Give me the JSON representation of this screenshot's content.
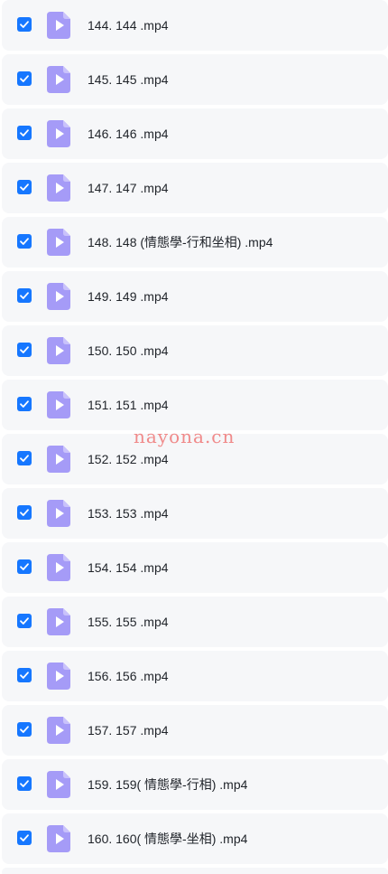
{
  "files": [
    {
      "name": "144. 144 .mp4",
      "checked": true
    },
    {
      "name": "145. 145 .mp4",
      "checked": true
    },
    {
      "name": "146. 146 .mp4",
      "checked": true
    },
    {
      "name": "147. 147 .mp4",
      "checked": true
    },
    {
      "name": "148. 148 (情態學-行和坐相) .mp4",
      "checked": true
    },
    {
      "name": "149. 149 .mp4",
      "checked": true
    },
    {
      "name": "150. 150 .mp4",
      "checked": true
    },
    {
      "name": "151. 151 .mp4",
      "checked": true
    },
    {
      "name": "152. 152 .mp4",
      "checked": true
    },
    {
      "name": "153. 153 .mp4",
      "checked": true
    },
    {
      "name": "154. 154 .mp4",
      "checked": true
    },
    {
      "name": "155. 155 .mp4",
      "checked": true
    },
    {
      "name": "156. 156 .mp4",
      "checked": true
    },
    {
      "name": "157. 157 .mp4",
      "checked": true
    },
    {
      "name": "159. 159( 情態學-行相) .mp4",
      "checked": true
    },
    {
      "name": "160. 160( 情態學-坐相) .mp4",
      "checked": true
    }
  ],
  "watermark": "nayona.cn",
  "colors": {
    "checkbox": "#1677ff",
    "file_icon": "#a59bf7",
    "row_background": "#f6f7f9",
    "watermark": "#f08a8a"
  },
  "icons": {
    "checkbox": "checkmark-icon",
    "file": "video-file-icon"
  }
}
